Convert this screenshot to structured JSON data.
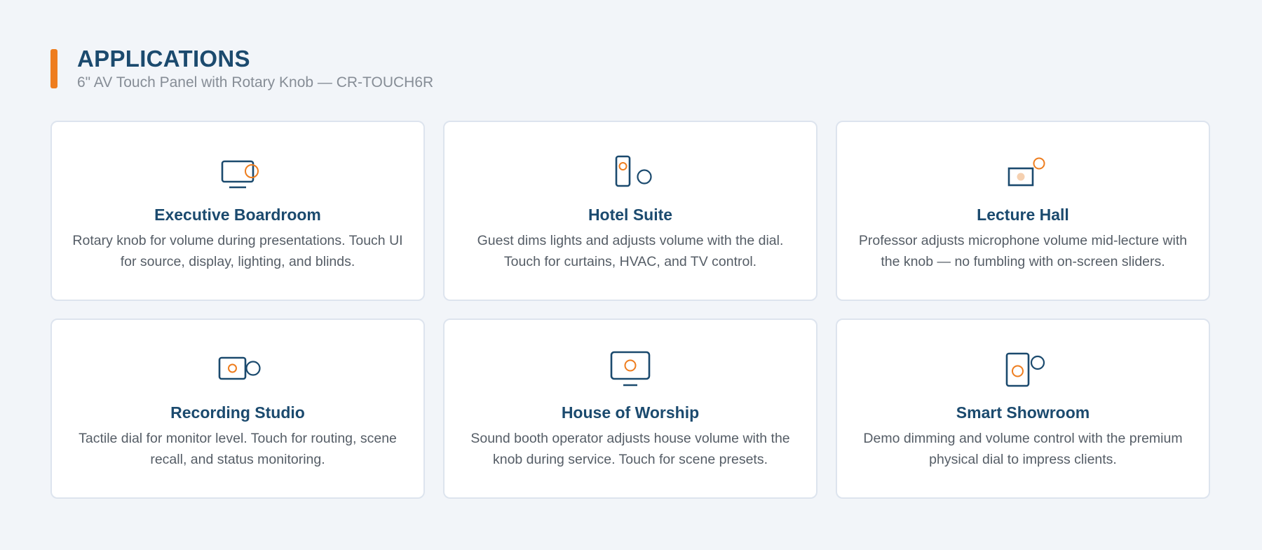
{
  "header": {
    "title": "APPLICATIONS",
    "subtitle": "6\" AV Touch Panel with Rotary Knob — CR-TOUCH6R"
  },
  "colors": {
    "accent": "#ee7d1e",
    "primary": "#1b4a6e",
    "background": "#f2f5f9"
  },
  "cards": [
    {
      "icon": "monitor-knob-icon",
      "title": "Executive Boardroom",
      "description": "Rotary knob for volume during presentations. Touch UI for source, display, lighting, and blinds."
    },
    {
      "icon": "phone-knob-icon",
      "title": "Hotel Suite",
      "description": "Guest dims lights and adjusts volume with the dial. Touch for curtains, HVAC, and TV control."
    },
    {
      "icon": "lecture-panel-icon",
      "title": "Lecture Hall",
      "description": "Professor adjusts microphone volume mid-lecture with the knob — no fumbling with on-screen sliders."
    },
    {
      "icon": "studio-panel-icon",
      "title": "Recording Studio",
      "description": "Tactile dial for monitor level. Touch for routing, scene recall, and status monitoring."
    },
    {
      "icon": "display-knob-icon",
      "title": "House of Worship",
      "description": "Sound booth operator adjusts house volume with the knob during service. Touch for scene presets."
    },
    {
      "icon": "tablet-knob-icon",
      "title": "Smart Showroom",
      "description": "Demo dimming and volume control with the premium physical dial to impress clients."
    }
  ]
}
